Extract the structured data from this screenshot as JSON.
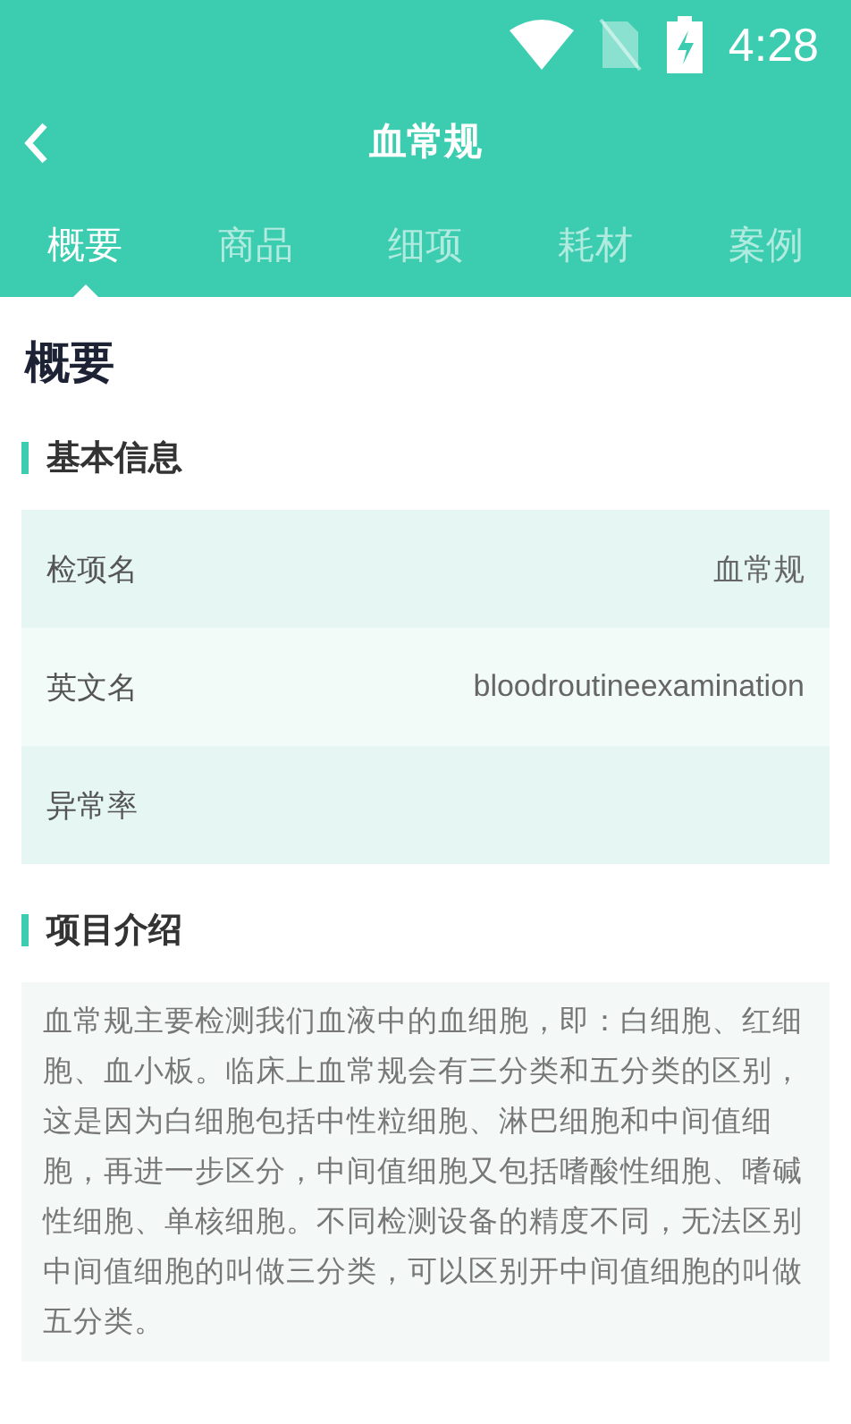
{
  "status_bar": {
    "time": "4:28"
  },
  "header": {
    "title": "血常规"
  },
  "tabs": [
    {
      "label": "概要",
      "selected": true
    },
    {
      "label": "商品",
      "selected": false
    },
    {
      "label": "细项",
      "selected": false
    },
    {
      "label": "耗材",
      "selected": false
    },
    {
      "label": "案例",
      "selected": false
    }
  ],
  "page_title": "概要",
  "basic_info": {
    "heading": "基本信息",
    "rows": [
      {
        "label": "检项名",
        "value": "血常规"
      },
      {
        "label": "英文名",
        "value": "bloodroutineexamination"
      },
      {
        "label": "异常率"
      }
    ]
  },
  "intro": {
    "heading": "项目介绍",
    "text": "血常规主要检测我们血液中的血细胞，即：白细胞、红细胞、血小板。临床上血常规会有三分类和五分类的区别，这是因为白细胞包括中性粒细胞、淋巴细胞和中间值细胞，再进一步区分，中间值细胞又包括嗜酸性细胞、嗜碱性细胞、单核细胞。不同检测设备的精度不同，无法区别中间值细胞的叫做三分类，可以区别开中间值细胞的叫做五分类。"
  }
}
